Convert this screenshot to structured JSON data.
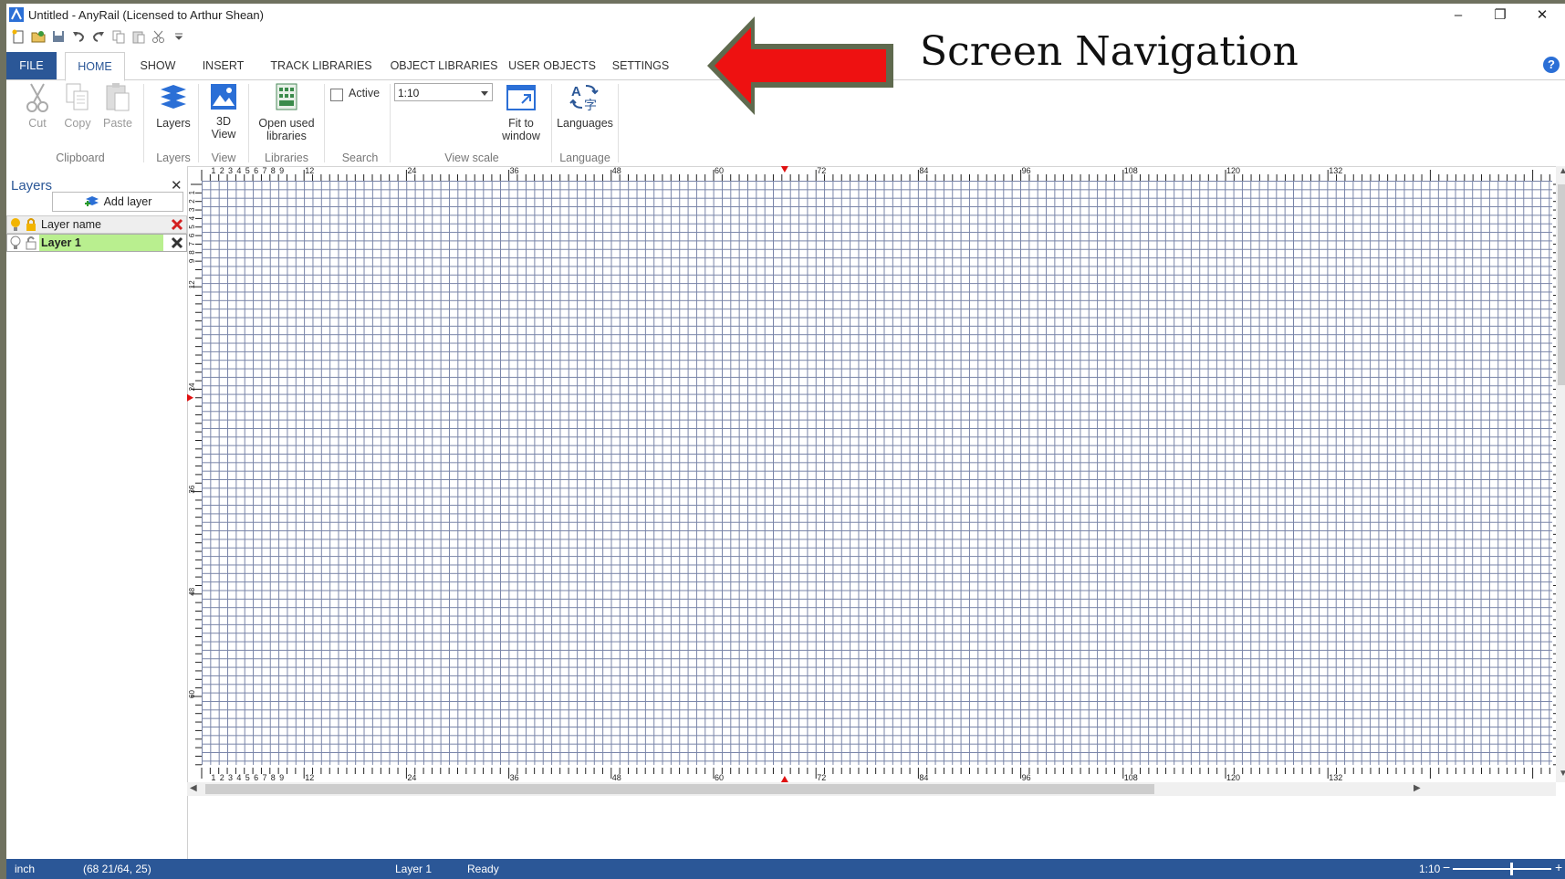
{
  "window": {
    "title": "Untitled - AnyRail (Licensed to Arthur Shean)"
  },
  "overlay": {
    "title": "Screen Navigation"
  },
  "tabs": [
    {
      "label": "FILE"
    },
    {
      "label": "HOME"
    },
    {
      "label": "SHOW"
    },
    {
      "label": "INSERT"
    },
    {
      "label": "TRACK LIBRARIES"
    },
    {
      "label": "OBJECT LIBRARIES"
    },
    {
      "label": "USER OBJECTS"
    },
    {
      "label": "SETTINGS"
    }
  ],
  "ribbon": {
    "cut": "Cut",
    "copy": "Copy",
    "paste": "Paste",
    "layers": "Layers",
    "view3d_1": "3D",
    "view3d_2": "View",
    "open_used_1": "Open used",
    "open_used_2": "libraries",
    "active": "Active",
    "scale_value": "1:10",
    "fit_1": "Fit to",
    "fit_2": "window",
    "languages": "Languages",
    "groups": {
      "clipboard": "Clipboard",
      "layers": "Layers",
      "view": "View",
      "libraries": "Libraries",
      "search": "Search",
      "view_scale": "View scale",
      "language": "Language"
    }
  },
  "layers_panel": {
    "title": "Layers",
    "add_layer": "Add layer",
    "header_name": "Layer name",
    "rows": [
      {
        "name": "Layer 1"
      }
    ]
  },
  "rulers": {
    "small_labels": [
      "1",
      "2",
      "3",
      "4",
      "5",
      "6",
      "7",
      "8",
      "9"
    ],
    "labels": [
      "12",
      "24",
      "36",
      "48",
      "60",
      "72",
      "84",
      "96",
      "108",
      "120",
      "132"
    ],
    "vertical_small": [
      "1",
      "2",
      "3",
      "4",
      "5",
      "6",
      "7",
      "8",
      "9"
    ],
    "vertical_labels": [
      "12",
      "24",
      "36",
      "48",
      "60"
    ]
  },
  "status": {
    "unit": "inch",
    "coords": "(68 21/64, 25)",
    "layer": "Layer 1",
    "state": "Ready",
    "zoom": "1:10",
    "minus": "−",
    "plus": "+"
  },
  "colors": {
    "accent": "#2b5797",
    "arrow": "#ee1111",
    "layer_active": "#b9ef8f"
  }
}
